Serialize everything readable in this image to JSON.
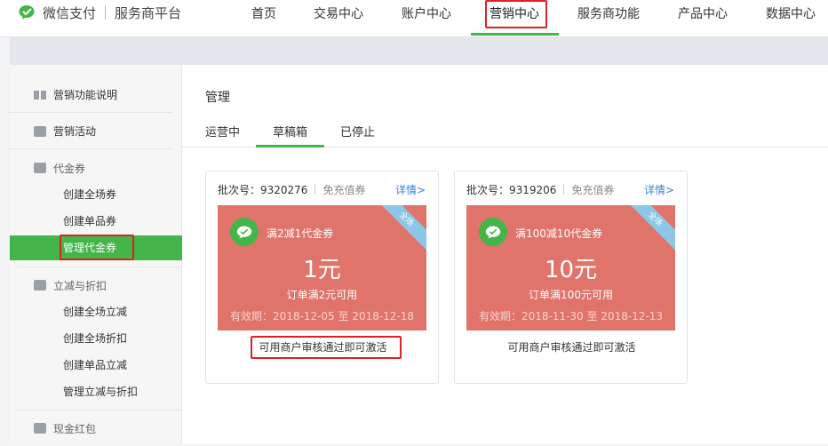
{
  "header": {
    "brand": "微信支付",
    "platform": "服务商平台",
    "nav": [
      "首页",
      "交易中心",
      "账户中心",
      "营销中心",
      "服务商功能",
      "产品中心",
      "数据中心"
    ],
    "active_nav": "营销中心"
  },
  "sidebar": {
    "sections": [
      {
        "label": "营销功能说明",
        "icon": "book-icon"
      },
      {
        "label": "营销活动",
        "icon": "gift-icon"
      },
      {
        "label": "代金券",
        "icon": "coupon-icon"
      },
      {
        "label": "立减与折扣",
        "icon": "discount-icon"
      },
      {
        "label": "现金红包",
        "icon": "red-packet-icon"
      }
    ],
    "voucher_items": [
      "创建全场券",
      "创建单品券",
      "管理代金券"
    ],
    "discount_items": [
      "创建全场立减",
      "创建全场折扣",
      "创建单品立减",
      "管理立减与折扣"
    ],
    "active_item": "管理代金券"
  },
  "main": {
    "title": "管理",
    "tabs": [
      "运营中",
      "草稿箱",
      "已停止"
    ],
    "active_tab": "草稿箱",
    "cards": [
      {
        "batch": "批次号：9320276",
        "type": "免充值券",
        "detail": "详情>",
        "name": "满2减1代金券",
        "amount": "1元",
        "condition": "订单满2元可用",
        "validity": "有效期：2018-12-05 至 2018-12-18",
        "ribbon": "全场",
        "action": "可用商户审核通过即可激活"
      },
      {
        "batch": "批次号：9319206",
        "type": "免充值券",
        "detail": "详情>",
        "name": "满100减10代金券",
        "amount": "10元",
        "condition": "订单满100元可用",
        "validity": "有效期：2018-11-30 至 2018-12-13",
        "ribbon": "全场",
        "action": "可用商户审核通过即可激活"
      }
    ]
  },
  "colors": {
    "accent": "#44b549",
    "coupon": "#e0746b",
    "highlight": "#e02020",
    "link": "#3b7dd8"
  }
}
